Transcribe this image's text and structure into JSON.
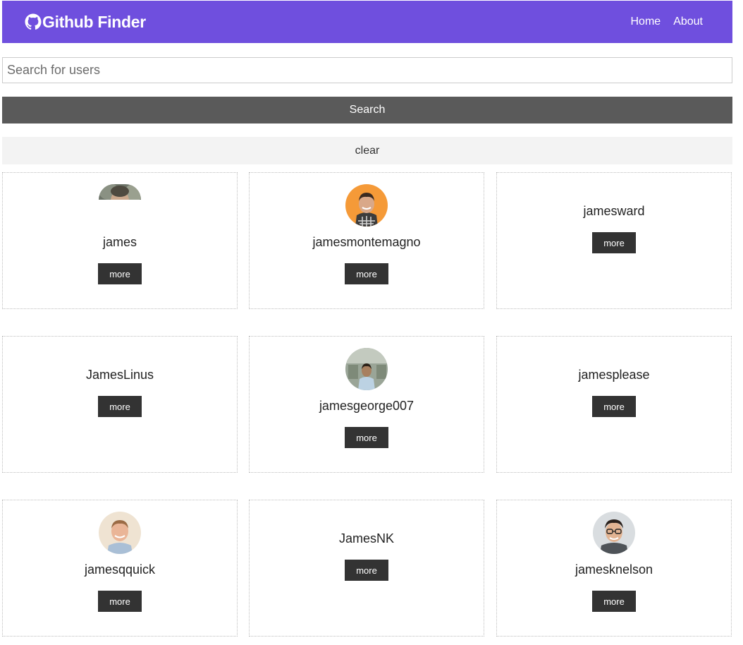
{
  "navbar": {
    "brand": "Github Finder",
    "brand_icon": "github-icon",
    "links": [
      "Home",
      "About"
    ],
    "color": "#6f4fde"
  },
  "search": {
    "placeholder": "Search for users",
    "value": "",
    "button_label": "Search",
    "clear_label": "clear"
  },
  "users": [
    {
      "login": "james",
      "avatar": "partial",
      "more": "more"
    },
    {
      "login": "jamesmontemagno",
      "avatar": "orange",
      "more": "more"
    },
    {
      "login": "jamesward",
      "avatar": "none",
      "more": "more"
    },
    {
      "login": "JamesLinus",
      "avatar": "none",
      "more": "more"
    },
    {
      "login": "jamesgeorge007",
      "avatar": "office",
      "more": "more"
    },
    {
      "login": "jamesplease",
      "avatar": "none",
      "more": "more"
    },
    {
      "login": "jamesqquick",
      "avatar": "light",
      "more": "more"
    },
    {
      "login": "JamesNK",
      "avatar": "none",
      "more": "more"
    },
    {
      "login": "jamesknelson",
      "avatar": "glasses",
      "more": "more"
    }
  ],
  "colors": {
    "search_button": "#5a5a5a",
    "clear_button": "#f3f3f3",
    "more_button": "#333333"
  }
}
